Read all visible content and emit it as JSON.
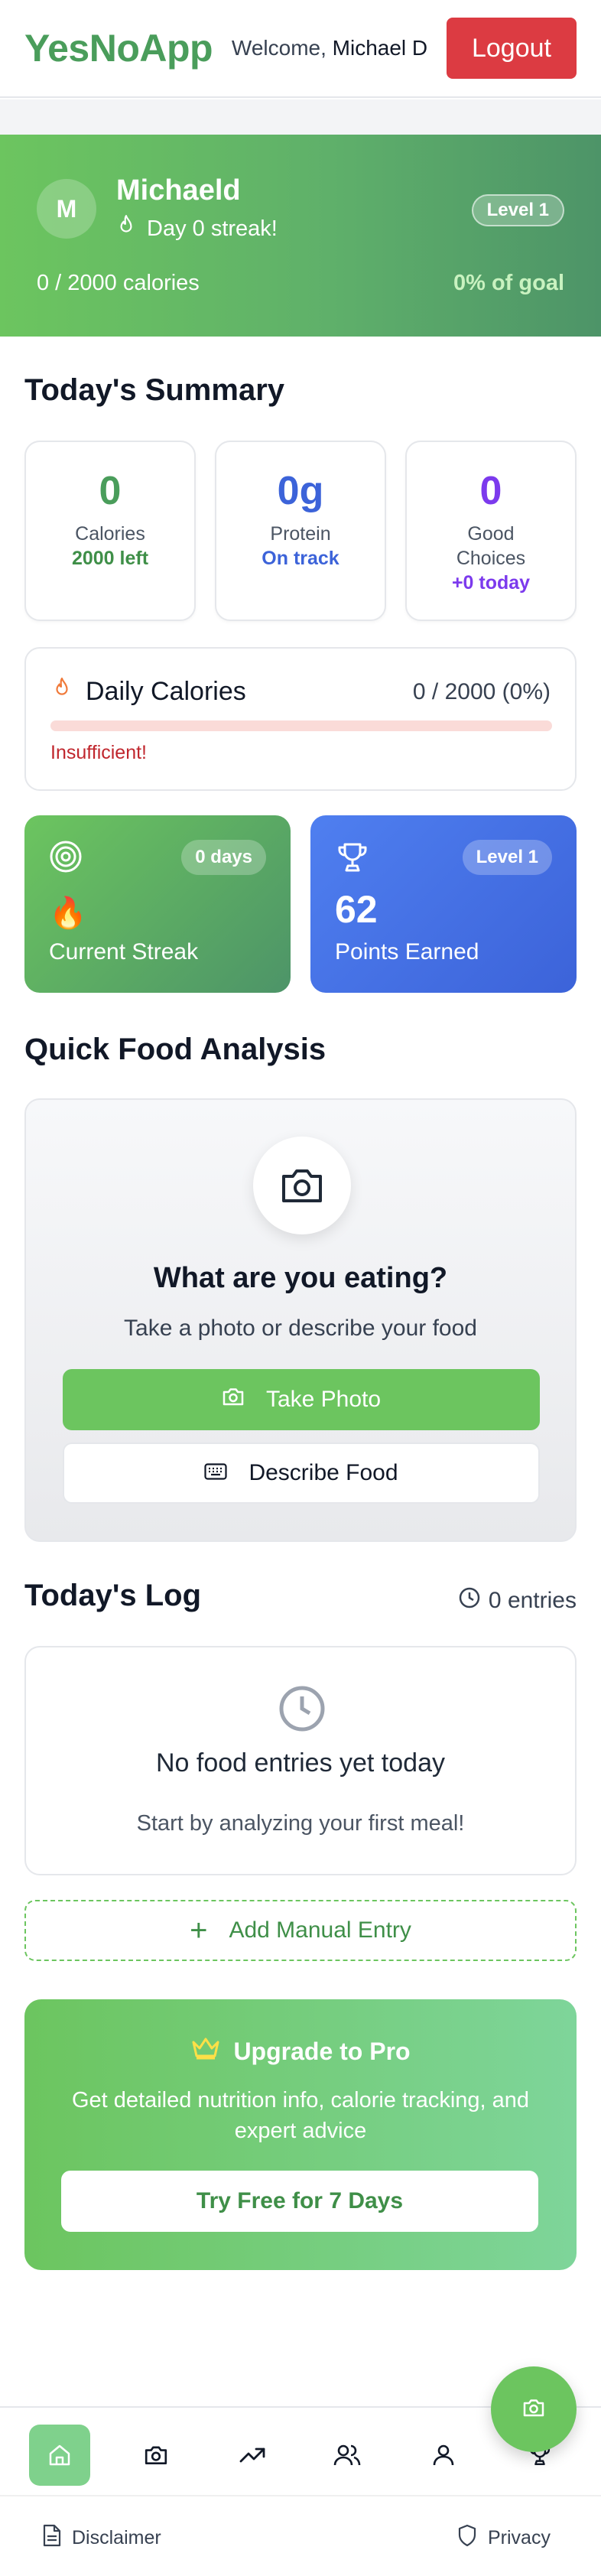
{
  "header": {
    "brand": "YesNoApp",
    "welcome_prefix": "Welcome,",
    "user_name": "Michael D",
    "logout_label": "Logout"
  },
  "profile": {
    "avatar_initial": "M",
    "name": "Michaeld",
    "streak_text": "Day 0 streak!",
    "level": "Level 1",
    "calories_text": "0 / 2000 calories",
    "goal_percent_text": "0% of goal"
  },
  "summary": {
    "title": "Today's Summary",
    "cards": [
      {
        "value": "0",
        "label": "Calories",
        "sub": "2000 left",
        "value_color": "#4a9d5b",
        "sub_color": "#3f8f48"
      },
      {
        "value": "0g",
        "label": "Protein",
        "sub": "On track",
        "value_color": "#3c63d9",
        "sub_color": "#3c63d9"
      },
      {
        "value": "0",
        "label": "Good Choices",
        "sub": "+0 today",
        "value_color": "#7c3aed",
        "sub_color": "#7c3aed"
      }
    ]
  },
  "daily_calories": {
    "title": "Daily Calories",
    "value_text": "0 / 2000 (0%)",
    "progress": 0,
    "status": "Insufficient!"
  },
  "tiles": {
    "streak": {
      "badge": "0 days",
      "emoji": "🔥",
      "label": "Current Streak"
    },
    "points": {
      "badge": "Level 1",
      "value": "62",
      "label": "Points Earned"
    }
  },
  "quick_food": {
    "title": "Quick Food Analysis",
    "heading": "What are you eating?",
    "subtitle": "Take a photo or describe your food",
    "take_photo_label": "Take Photo",
    "describe_label": "Describe Food"
  },
  "log": {
    "title": "Today's Log",
    "entries_text": "0 entries",
    "empty_title": "No food entries yet today",
    "empty_sub": "Start by analyzing your first meal!",
    "add_label": "Add Manual Entry"
  },
  "upgrade": {
    "title": "Upgrade to Pro",
    "description": "Get detailed nutrition info, calorie tracking, and expert advice",
    "button_label": "Try Free for 7 Days"
  },
  "bottom_nav": [
    "home-icon",
    "camera-icon",
    "trending-icon",
    "users-icon",
    "user-icon",
    "trophy-icon"
  ],
  "footer": {
    "disclaimer_label": "Disclaimer",
    "privacy_label": "Privacy"
  },
  "colors": {
    "brand_green": "#6cc55f",
    "logout_red": "#dc3b42",
    "points_blue": "#3c63d9"
  }
}
